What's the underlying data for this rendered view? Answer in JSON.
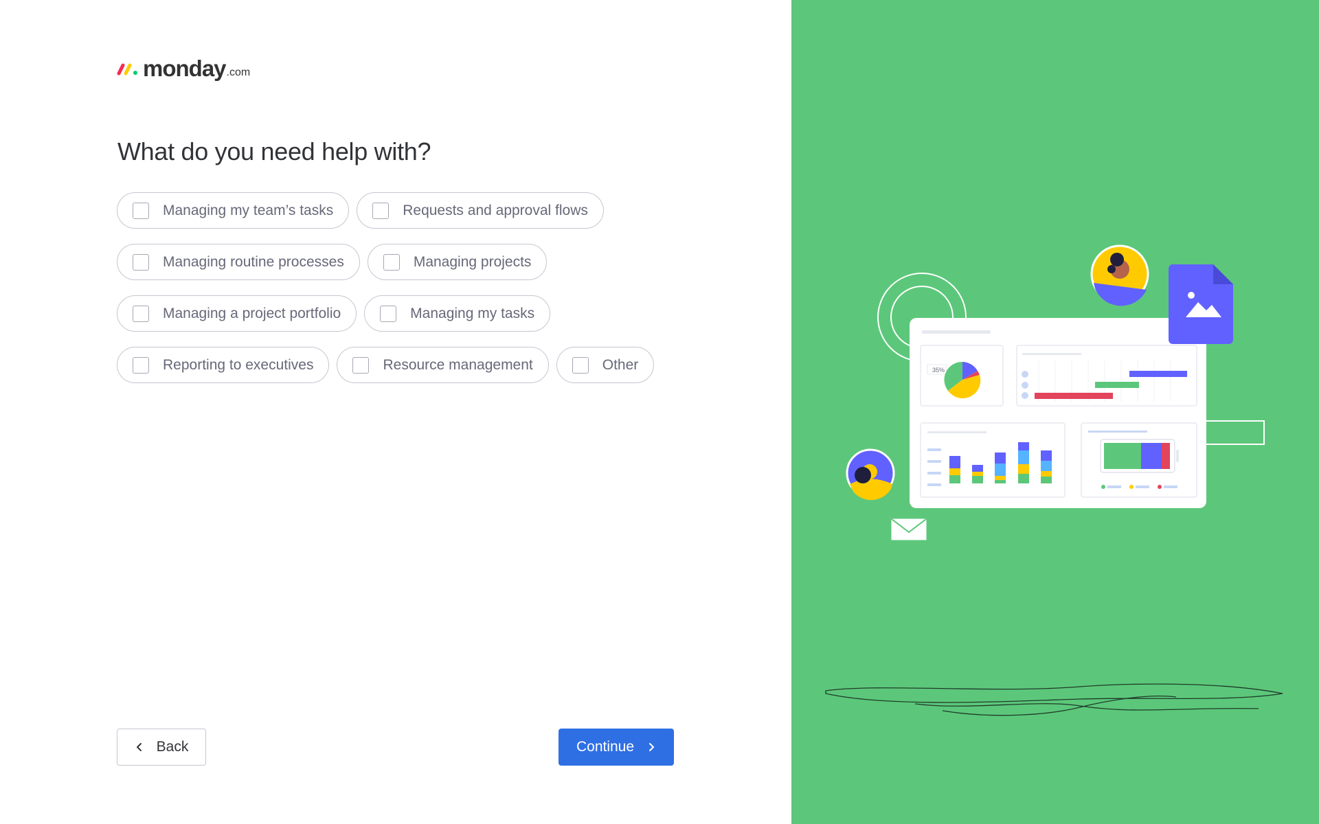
{
  "brand": {
    "logo_word": "monday",
    "logo_tld": ".com"
  },
  "question": "What do you need help with?",
  "options": [
    {
      "label": "Managing my team’s tasks"
    },
    {
      "label": "Requests and approval flows"
    },
    {
      "label": "Managing routine processes"
    },
    {
      "label": "Managing projects"
    },
    {
      "label": "Managing a project portfolio"
    },
    {
      "label": "Managing my tasks"
    },
    {
      "label": "Reporting to executives"
    },
    {
      "label": "Resource management"
    },
    {
      "label": "Other"
    }
  ],
  "buttons": {
    "back_label": "Back",
    "continue_label": "Continue"
  },
  "illustration": {
    "pie_label": "35%"
  },
  "colors": {
    "panel_green": "#5cc77a",
    "primary_blue": "#2f6fe4",
    "accent_purple": "#6161ff",
    "accent_yellow": "#ffcb00",
    "accent_red": "#e2445c"
  }
}
